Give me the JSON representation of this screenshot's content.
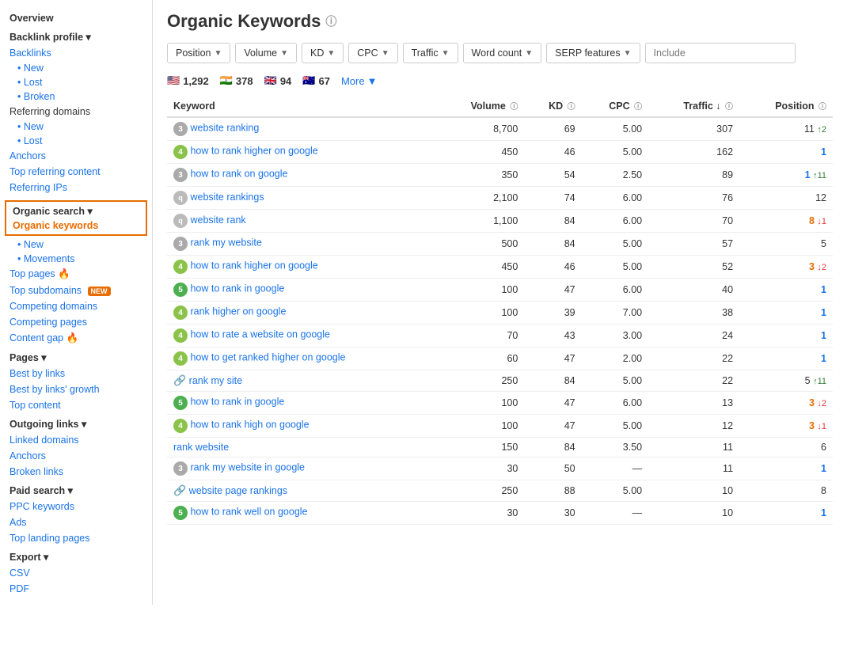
{
  "sidebar": {
    "overview": "Overview",
    "backlink_profile": "Backlink profile ▾",
    "backlinks": "Backlinks",
    "backlinks_sub": [
      "New",
      "Lost",
      "Broken"
    ],
    "referring_domains": "Referring domains",
    "referring_sub": [
      "New",
      "Lost"
    ],
    "anchors": "Anchors",
    "top_referring": "Top referring content",
    "referring_ips": "Referring IPs",
    "organic_search": "Organic search ▾",
    "organic_keywords": "Organic keywords",
    "organic_sub": [
      "New",
      "Movements"
    ],
    "top_pages": "Top pages",
    "top_subdomains": "Top subdomains",
    "competing_domains": "Competing domains",
    "competing_pages": "Competing pages",
    "content_gap": "Content gap",
    "pages": "Pages ▾",
    "best_by_links": "Best by links",
    "best_by_growth": "Best by links' growth",
    "top_content": "Top content",
    "outgoing_links": "Outgoing links ▾",
    "linked_domains": "Linked domains",
    "anchors2": "Anchors",
    "broken_links": "Broken links",
    "paid_search": "Paid search ▾",
    "ppc_keywords": "PPC keywords",
    "ads": "Ads",
    "top_landing": "Top landing pages",
    "export": "Export ▾",
    "csv": "CSV",
    "pdf": "PDF"
  },
  "main": {
    "title": "Organic Keywords",
    "filters": {
      "position": "Position",
      "volume": "Volume",
      "kd": "KD",
      "cpc": "CPC",
      "traffic": "Traffic",
      "word_count": "Word count",
      "serp_features": "SERP features",
      "include_placeholder": "Include"
    },
    "flags": [
      {
        "flag": "🇺🇸",
        "count": "1,292"
      },
      {
        "flag": "🇮🇳",
        "count": "378"
      },
      {
        "flag": "🇬🇧",
        "count": "94"
      },
      {
        "flag": "🇦🇺",
        "count": "67"
      }
    ],
    "more": "More",
    "columns": [
      "Keyword",
      "Volume",
      "KD",
      "CPC",
      "Traffic",
      "Position"
    ],
    "rows": [
      {
        "keyword": "website ranking",
        "badge": "3",
        "badge_class": "b3",
        "volume": "8,700",
        "kd": "69",
        "cpc": "5.00",
        "traffic": "307",
        "position": "11",
        "pos_class": "",
        "change": "↑2",
        "change_class": "arrow-up"
      },
      {
        "keyword": "how to rank higher on google",
        "badge": "4",
        "badge_class": "b4",
        "volume": "450",
        "kd": "46",
        "cpc": "5.00",
        "traffic": "162",
        "position": "1",
        "pos_class": "pos-blue",
        "change": "",
        "change_class": ""
      },
      {
        "keyword": "how to rank on google",
        "badge": "3",
        "badge_class": "b3",
        "volume": "350",
        "kd": "54",
        "cpc": "2.50",
        "traffic": "89",
        "position": "1",
        "pos_class": "pos-blue",
        "change": "↑11",
        "change_class": "arrow-up"
      },
      {
        "keyword": "website rankings",
        "badge": "q",
        "badge_class": "bq",
        "volume": "2,100",
        "kd": "74",
        "cpc": "6.00",
        "traffic": "76",
        "position": "12",
        "pos_class": "",
        "change": "",
        "change_class": ""
      },
      {
        "keyword": "website rank",
        "badge": "q",
        "badge_class": "bq",
        "volume": "1,100",
        "kd": "84",
        "cpc": "6.00",
        "traffic": "70",
        "position": "8",
        "pos_class": "pos-orange",
        "change": "↓1",
        "change_class": "arrow-down"
      },
      {
        "keyword": "rank my website",
        "badge": "3",
        "badge_class": "b3",
        "volume": "500",
        "kd": "84",
        "cpc": "5.00",
        "traffic": "57",
        "position": "5",
        "pos_class": "",
        "change": "",
        "change_class": ""
      },
      {
        "keyword": "how to rank higher on google",
        "badge": "4",
        "badge_class": "b4",
        "volume": "450",
        "kd": "46",
        "cpc": "5.00",
        "traffic": "52",
        "position": "3",
        "pos_class": "pos-orange",
        "change": "↓2",
        "change_class": "arrow-down"
      },
      {
        "keyword": "how to rank in google",
        "badge": "5",
        "badge_class": "b5",
        "volume": "100",
        "kd": "47",
        "cpc": "6.00",
        "traffic": "40",
        "position": "1",
        "pos_class": "pos-blue",
        "change": "",
        "change_class": ""
      },
      {
        "keyword": "rank higher on google",
        "badge": "4",
        "badge_class": "b4",
        "volume": "100",
        "kd": "39",
        "cpc": "7.00",
        "traffic": "38",
        "position": "1",
        "pos_class": "pos-blue",
        "change": "",
        "change_class": ""
      },
      {
        "keyword": "how to rate a website on google",
        "badge": "4",
        "badge_class": "b4",
        "volume": "70",
        "kd": "43",
        "cpc": "3.00",
        "traffic": "24",
        "position": "1",
        "pos_class": "pos-blue",
        "change": "",
        "change_class": ""
      },
      {
        "keyword": "how to get ranked higher on google",
        "badge": "4",
        "badge_class": "b4",
        "volume": "60",
        "kd": "47",
        "cpc": "2.00",
        "traffic": "22",
        "position": "1",
        "pos_class": "pos-blue",
        "change": "",
        "change_class": ""
      },
      {
        "keyword": "rank my site",
        "badge": "chain",
        "badge_class": "chain",
        "volume": "250",
        "kd": "84",
        "cpc": "5.00",
        "traffic": "22",
        "position": "5",
        "pos_class": "",
        "change": "↑11",
        "change_class": "arrow-up"
      },
      {
        "keyword": "how to rank in google",
        "badge": "5",
        "badge_class": "b5",
        "volume": "100",
        "kd": "47",
        "cpc": "6.00",
        "traffic": "13",
        "position": "3",
        "pos_class": "pos-orange",
        "change": "↓2",
        "change_class": "arrow-down"
      },
      {
        "keyword": "how to rank high on google",
        "badge": "4",
        "badge_class": "b4",
        "volume": "100",
        "kd": "47",
        "cpc": "5.00",
        "traffic": "12",
        "position": "3",
        "pos_class": "pos-orange",
        "change": "↓1",
        "change_class": "arrow-down"
      },
      {
        "keyword": "rank website",
        "badge": "",
        "badge_class": "",
        "volume": "150",
        "kd": "84",
        "cpc": "3.50",
        "traffic": "11",
        "position": "6",
        "pos_class": "",
        "change": "",
        "change_class": ""
      },
      {
        "keyword": "rank my website in google",
        "badge": "3",
        "badge_class": "b3",
        "volume": "30",
        "kd": "50",
        "cpc": "—",
        "traffic": "11",
        "position": "1",
        "pos_class": "pos-blue",
        "change": "",
        "change_class": ""
      },
      {
        "keyword": "website page rankings",
        "badge": "chain",
        "badge_class": "chain",
        "volume": "250",
        "kd": "88",
        "cpc": "5.00",
        "traffic": "10",
        "position": "8",
        "pos_class": "",
        "change": "",
        "change_class": ""
      },
      {
        "keyword": "how to rank well on google",
        "badge": "5",
        "badge_class": "b5",
        "volume": "30",
        "kd": "30",
        "cpc": "—",
        "traffic": "10",
        "position": "1",
        "pos_class": "pos-blue",
        "change": "",
        "change_class": ""
      }
    ]
  }
}
